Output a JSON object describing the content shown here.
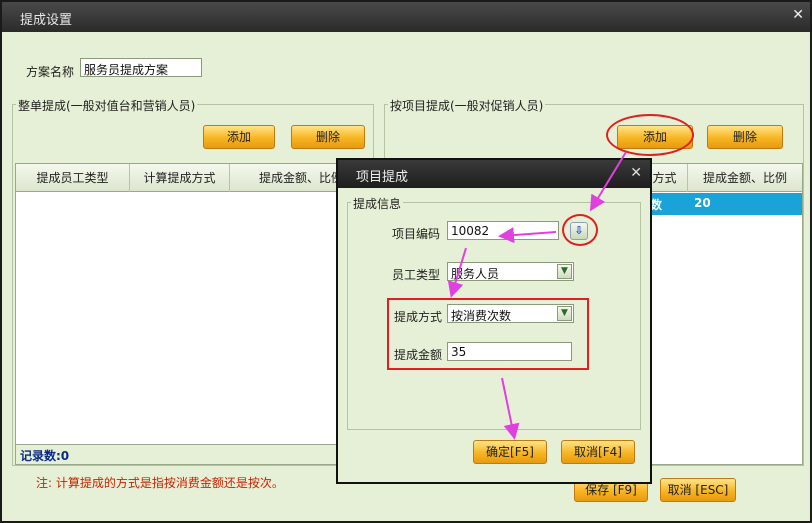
{
  "window": {
    "title": "提成设置"
  },
  "scheme": {
    "label": "方案名称",
    "value": "服务员提成方案"
  },
  "left_group": {
    "title": "整单提成(一般对值台和营销人员)",
    "add_label": "添加",
    "delete_label": "删除",
    "columns": [
      "提成员工类型",
      "计算提成方式",
      "提成金额、比例"
    ],
    "record_count": "记录数:0"
  },
  "right_group": {
    "title": "按项目提成(一般对促销人员)",
    "add_label": "添加",
    "delete_label": "删除",
    "columns": [
      "方式",
      "提成金额、比例"
    ],
    "row": {
      "method_tail": "数",
      "amount": "20"
    }
  },
  "note": "注: 计算提成的方式是指按消费金额还是按次。",
  "footer": {
    "save_label": "保存 [F9]",
    "cancel_label": "取消 [ESC]"
  },
  "dialog": {
    "title": "项目提成",
    "group_title": "提成信息",
    "item_code": {
      "label": "项目编码",
      "value": "10082"
    },
    "staff_type": {
      "label": "员工类型",
      "value": "服务人员"
    },
    "method": {
      "label": "提成方式",
      "value": "按消费次数"
    },
    "amount": {
      "label": "提成金额",
      "value": "35"
    },
    "ok_label": "确定[F5]",
    "cancel_label": "取消[F4]"
  },
  "colors": {
    "accent_button": "#f7b522",
    "selected_row": "#1aa3d8",
    "annotation_red": "#e02020",
    "annotation_arrow": "#e040e0"
  },
  "icons": {
    "close": "close-icon",
    "dropdown": "chevron-down-icon",
    "lookup": "arrow-down-icon"
  }
}
